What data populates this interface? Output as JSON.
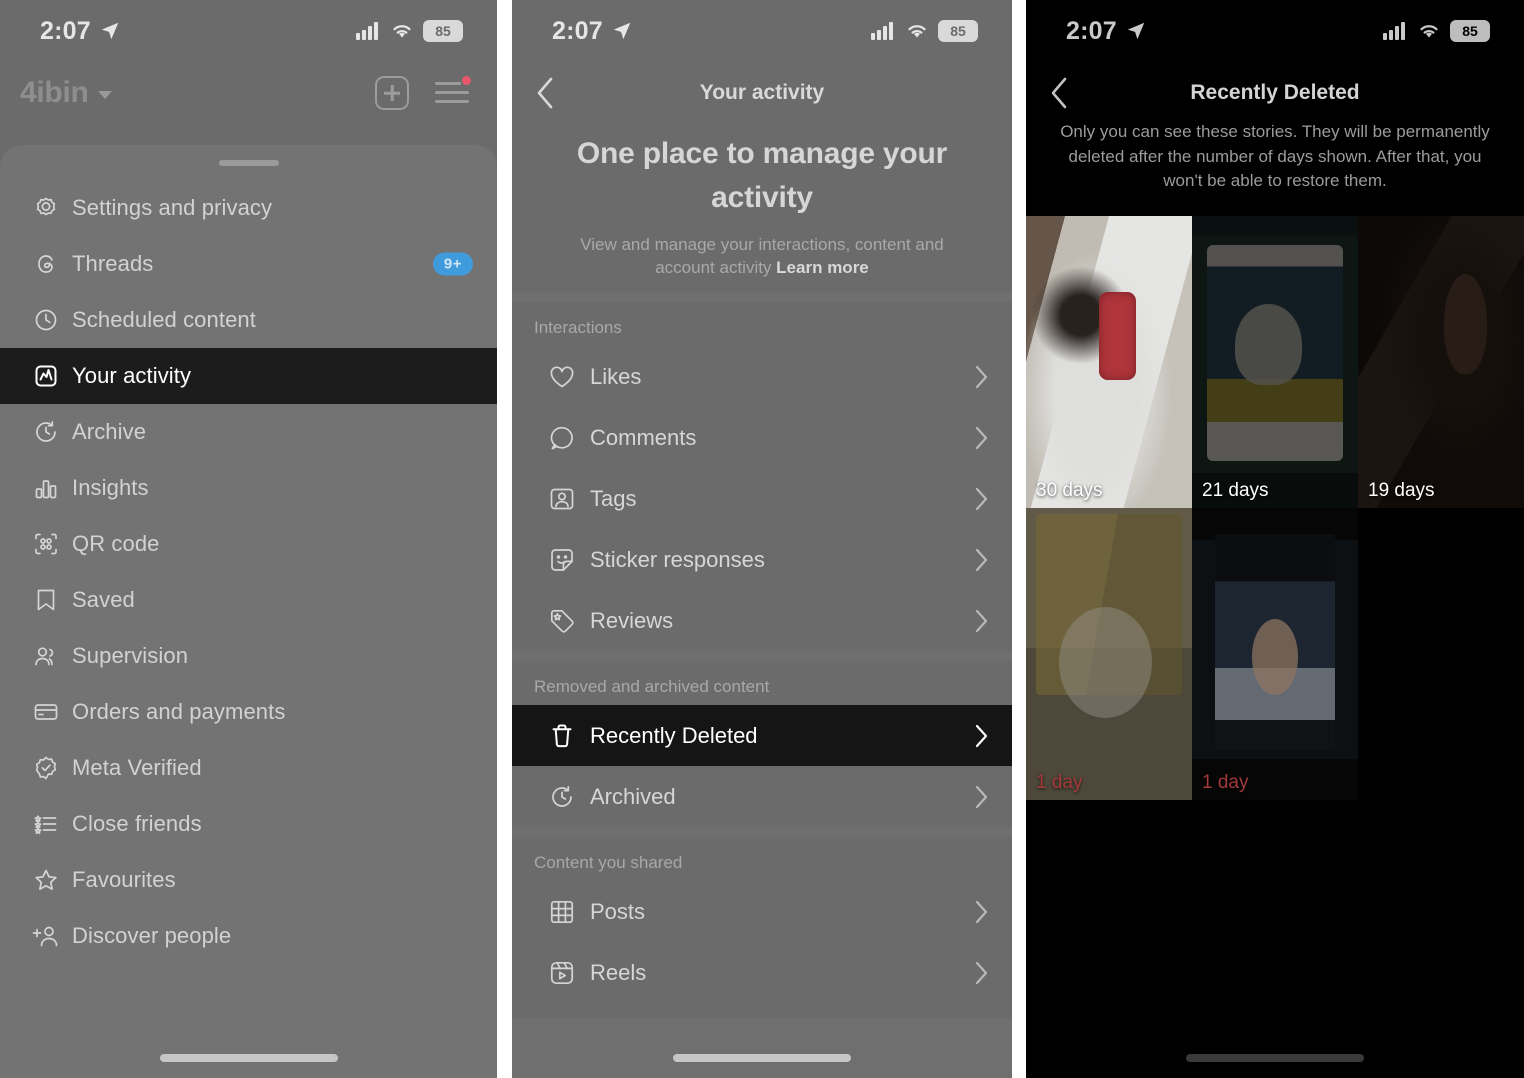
{
  "status_bar": {
    "time": "2:07",
    "battery": "85",
    "location_icon": "location-arrow-icon",
    "cellular_icon": "cellular-bars-icon",
    "wifi_icon": "wifi-icon"
  },
  "panel1": {
    "header": {
      "username": "4ibin",
      "chevron_icon": "chevron-down-icon",
      "new_post_icon": "plus-square-icon",
      "menu_icon": "hamburger-menu-icon"
    },
    "menu": [
      {
        "label": "Settings and privacy",
        "icon": "gear-icon",
        "selected": false,
        "badge": ""
      },
      {
        "label": "Threads",
        "icon": "threads-icon",
        "selected": false,
        "badge": "9+"
      },
      {
        "label": "Scheduled content",
        "icon": "clock-icon",
        "selected": false,
        "badge": ""
      },
      {
        "label": "Your activity",
        "icon": "activity-chart-icon",
        "selected": true,
        "badge": ""
      },
      {
        "label": "Archive",
        "icon": "archive-clock-icon",
        "selected": false,
        "badge": ""
      },
      {
        "label": "Insights",
        "icon": "bar-chart-icon",
        "selected": false,
        "badge": ""
      },
      {
        "label": "QR code",
        "icon": "qr-code-icon",
        "selected": false,
        "badge": ""
      },
      {
        "label": "Saved",
        "icon": "bookmark-icon",
        "selected": false,
        "badge": ""
      },
      {
        "label": "Supervision",
        "icon": "people-icon",
        "selected": false,
        "badge": ""
      },
      {
        "label": "Orders and payments",
        "icon": "credit-card-icon",
        "selected": false,
        "badge": ""
      },
      {
        "label": "Meta Verified",
        "icon": "verified-badge-icon",
        "selected": false,
        "badge": ""
      },
      {
        "label": "Close friends",
        "icon": "star-list-icon",
        "selected": false,
        "badge": ""
      },
      {
        "label": "Favourites",
        "icon": "star-icon",
        "selected": false,
        "badge": ""
      },
      {
        "label": "Discover people",
        "icon": "add-person-icon",
        "selected": false,
        "badge": ""
      }
    ]
  },
  "panel2": {
    "nav": {
      "title": "Your activity",
      "back_icon": "chevron-left-icon"
    },
    "hero": {
      "title": "One place to manage your activity",
      "description": "View and manage your interactions, content and account activity ",
      "learn_more": "Learn more"
    },
    "sections": [
      {
        "title": "Interactions",
        "items": [
          {
            "label": "Likes",
            "icon": "heart-icon",
            "selected": false
          },
          {
            "label": "Comments",
            "icon": "comment-bubble-icon",
            "selected": false
          },
          {
            "label": "Tags",
            "icon": "tag-person-icon",
            "selected": false
          },
          {
            "label": "Sticker responses",
            "icon": "sticker-smiley-icon",
            "selected": false
          },
          {
            "label": "Reviews",
            "icon": "review-tag-icon",
            "selected": false
          }
        ]
      },
      {
        "title": "Removed and archived content",
        "items": [
          {
            "label": "Recently Deleted",
            "icon": "trash-icon",
            "selected": true
          },
          {
            "label": "Archived",
            "icon": "archive-clock-icon",
            "selected": false
          }
        ]
      },
      {
        "title": "Content you shared",
        "items": [
          {
            "label": "Posts",
            "icon": "grid-icon",
            "selected": false
          },
          {
            "label": "Reels",
            "icon": "reels-icon",
            "selected": false
          }
        ]
      }
    ]
  },
  "panel3": {
    "nav": {
      "title": "Recently Deleted",
      "back_icon": "chevron-left-icon"
    },
    "description": "Only you can see these stories. They will be permanently deleted after the number of days shown. After that, you won't be able to restore them.",
    "stories": [
      {
        "days_label": "30 days",
        "style": "bright",
        "art": "a1"
      },
      {
        "days_label": "21 days",
        "style": "dim",
        "art": "a2"
      },
      {
        "days_label": "19 days",
        "style": "dim",
        "art": "a3"
      },
      {
        "days_label": "1 day",
        "style": "red",
        "art": "a4"
      },
      {
        "days_label": "1 day",
        "style": "red",
        "art": "a5"
      }
    ]
  }
}
